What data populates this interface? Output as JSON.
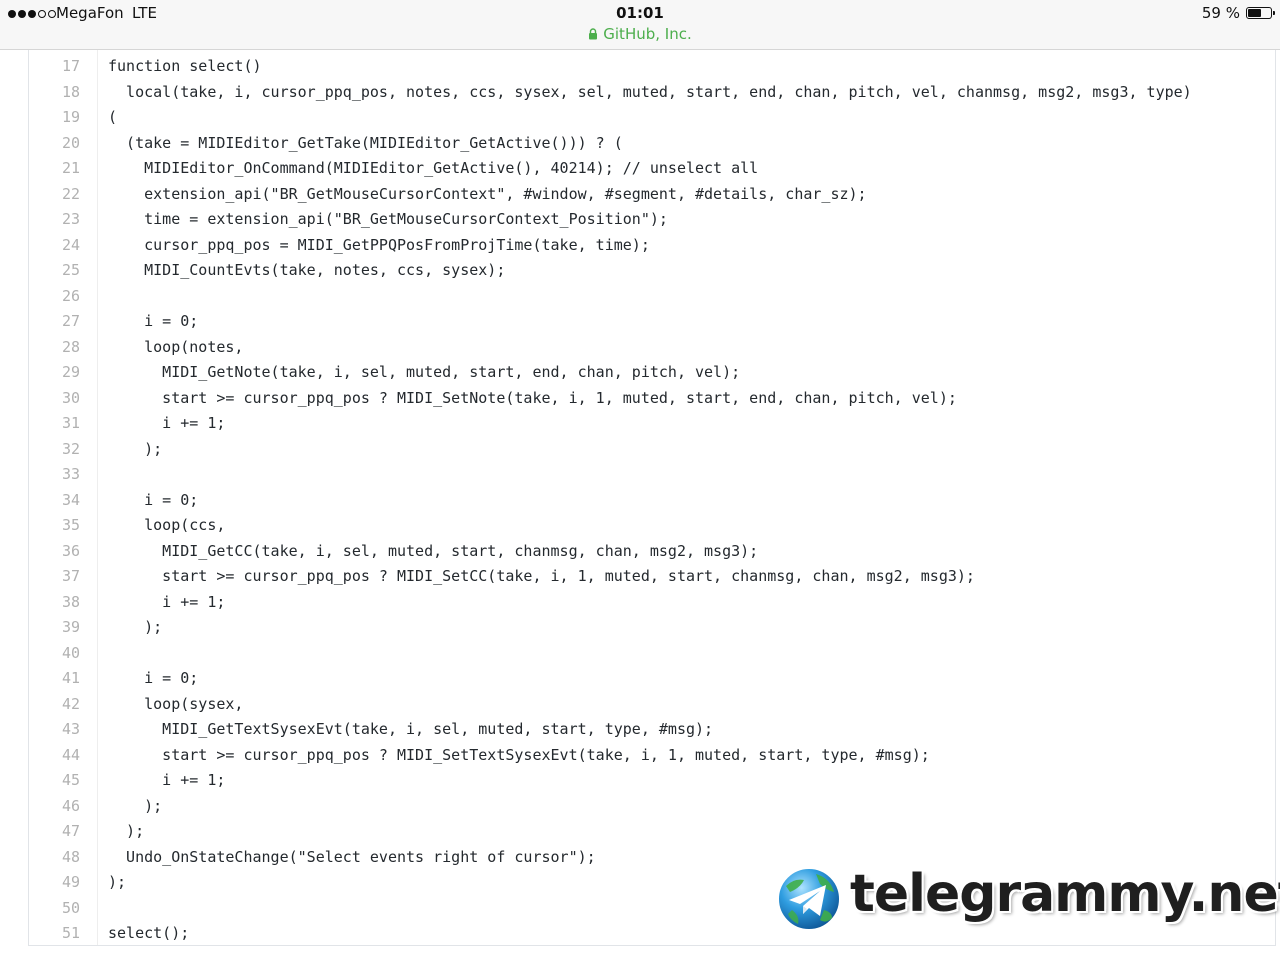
{
  "status_bar": {
    "signal_strength": 3,
    "signal_max": 5,
    "carrier": "MegaFon",
    "network": "LTE",
    "time": "01:01",
    "site": "GitHub, Inc.",
    "battery_text": "59 %",
    "battery_level": 0.59,
    "site_color": "#4cae4c"
  },
  "code": {
    "lines": [
      {
        "num": "17",
        "text": "function select()"
      },
      {
        "num": "18",
        "text": "  local(take, i, cursor_ppq_pos, notes, ccs, sysex, sel, muted, start, end, chan, pitch, vel, chanmsg, msg2, msg3, type)"
      },
      {
        "num": "19",
        "text": "("
      },
      {
        "num": "20",
        "text": "  (take = MIDIEditor_GetTake(MIDIEditor_GetActive())) ? ("
      },
      {
        "num": "21",
        "text": "    MIDIEditor_OnCommand(MIDIEditor_GetActive(), 40214); // unselect all"
      },
      {
        "num": "22",
        "text": "    extension_api(\"BR_GetMouseCursorContext\", #window, #segment, #details, char_sz);"
      },
      {
        "num": "23",
        "text": "    time = extension_api(\"BR_GetMouseCursorContext_Position\");"
      },
      {
        "num": "24",
        "text": "    cursor_ppq_pos = MIDI_GetPPQPosFromProjTime(take, time);"
      },
      {
        "num": "25",
        "text": "    MIDI_CountEvts(take, notes, ccs, sysex);"
      },
      {
        "num": "26",
        "text": ""
      },
      {
        "num": "27",
        "text": "    i = 0;"
      },
      {
        "num": "28",
        "text": "    loop(notes,"
      },
      {
        "num": "29",
        "text": "      MIDI_GetNote(take, i, sel, muted, start, end, chan, pitch, vel);"
      },
      {
        "num": "30",
        "text": "      start >= cursor_ppq_pos ? MIDI_SetNote(take, i, 1, muted, start, end, chan, pitch, vel);"
      },
      {
        "num": "31",
        "text": "      i += 1;"
      },
      {
        "num": "32",
        "text": "    );"
      },
      {
        "num": "33",
        "text": ""
      },
      {
        "num": "34",
        "text": "    i = 0;"
      },
      {
        "num": "35",
        "text": "    loop(ccs,"
      },
      {
        "num": "36",
        "text": "      MIDI_GetCC(take, i, sel, muted, start, chanmsg, chan, msg2, msg3);"
      },
      {
        "num": "37",
        "text": "      start >= cursor_ppq_pos ? MIDI_SetCC(take, i, 1, muted, start, chanmsg, chan, msg2, msg3);"
      },
      {
        "num": "38",
        "text": "      i += 1;"
      },
      {
        "num": "39",
        "text": "    );"
      },
      {
        "num": "40",
        "text": ""
      },
      {
        "num": "41",
        "text": "    i = 0;"
      },
      {
        "num": "42",
        "text": "    loop(sysex,"
      },
      {
        "num": "43",
        "text": "      MIDI_GetTextSysexEvt(take, i, sel, muted, start, type, #msg);"
      },
      {
        "num": "44",
        "text": "      start >= cursor_ppq_pos ? MIDI_SetTextSysexEvt(take, i, 1, muted, start, type, #msg);"
      },
      {
        "num": "45",
        "text": "      i += 1;"
      },
      {
        "num": "46",
        "text": "    );"
      },
      {
        "num": "47",
        "text": "  );"
      },
      {
        "num": "48",
        "text": "  Undo_OnStateChange(\"Select events right of cursor\");"
      },
      {
        "num": "49",
        "text": ");"
      },
      {
        "num": "50",
        "text": ""
      },
      {
        "num": "51",
        "text": "select();"
      }
    ]
  },
  "watermark": {
    "text": "telegrammy.net",
    "icon": "telegram-globe-icon"
  }
}
